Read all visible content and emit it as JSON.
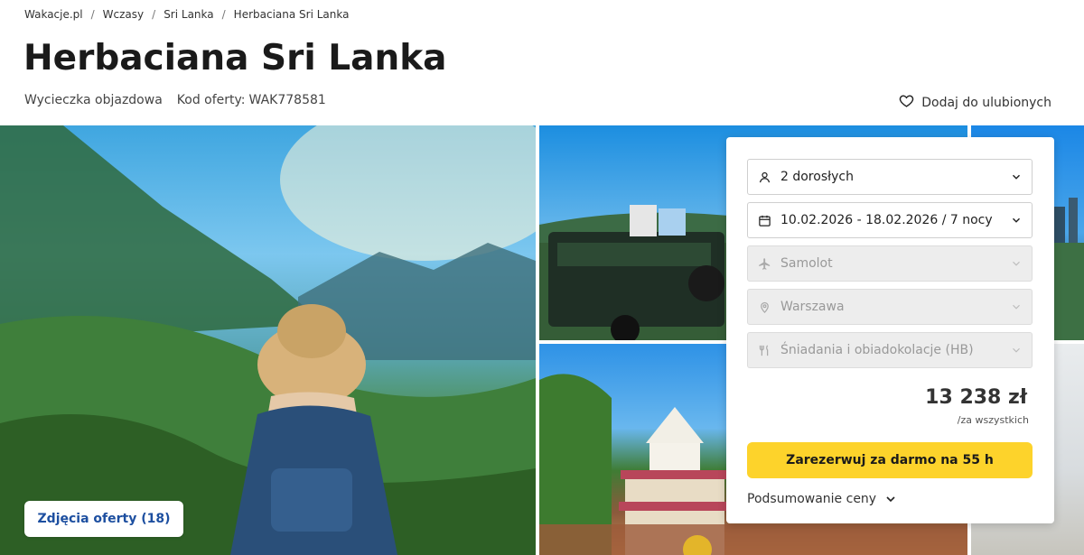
{
  "breadcrumb": {
    "items": [
      "Wakacje.pl",
      "Wczasy",
      "Sri Lanka",
      "Herbaciana Sri Lanka"
    ],
    "separator": "/"
  },
  "page": {
    "title": "Herbaciana Sri Lanka",
    "trip_type": "Wycieczka objazdowa",
    "offer_code_label": "Kod oferty:",
    "offer_code": "WAK778581",
    "favorite_label": "Dodaj do ulubionych"
  },
  "gallery": {
    "photos_button": "Zdjęcia oferty (18)"
  },
  "booking": {
    "travelers": "2 dorosłych",
    "dates": "10.02.2026 - 18.02.2026 / 7 nocy",
    "transport": "Samolot",
    "departure": "Warszawa",
    "board": "Śniadania i obiadokolacje (HB)",
    "price": "13 238 zł",
    "price_note": "/za wszystkich",
    "book_button": "Zarezerwuj za darmo na 55 h",
    "summary_label": "Podsumowanie ceny"
  },
  "colors": {
    "accent_yellow": "#fdd32b",
    "link_blue": "#1d4fa0"
  },
  "icons": {
    "favorite": "heart-icon",
    "travelers": "person-icon",
    "dates": "calendar-icon",
    "transport": "plane-icon",
    "departure": "location-pin-icon",
    "board": "cutlery-icon",
    "dropdown": "chevron-down-icon"
  }
}
